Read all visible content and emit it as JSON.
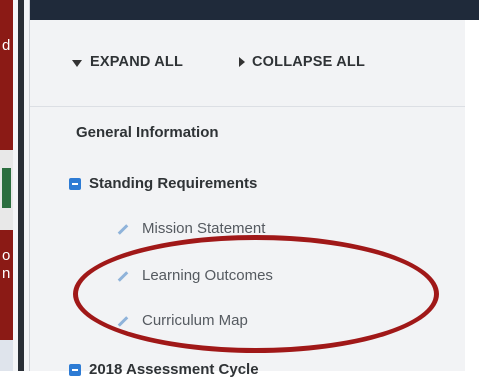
{
  "left_strip": {
    "chars": [
      "d",
      "o",
      "n"
    ]
  },
  "toolbar": {
    "expand_all_label": "EXPAND ALL",
    "collapse_all_label": "COLLAPSE ALL"
  },
  "outline": {
    "general_information": "General Information",
    "standing_requirements": {
      "label": "Standing Requirements",
      "children": [
        "Mission Statement",
        "Learning Outcomes",
        "Curriculum Map"
      ]
    },
    "assessment_cycle": "2018 Assessment Cycle"
  },
  "annotation": {
    "ellipse_color": "#a01818"
  },
  "colors": {
    "accent_blue": "#2d7bd4",
    "text_dark": "#2f3336"
  }
}
